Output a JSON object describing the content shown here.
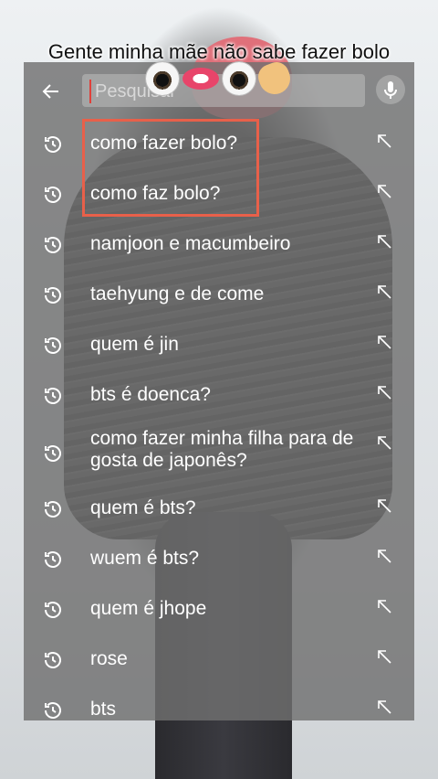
{
  "caption": "Gente minha mãe não sabe fazer bolo",
  "search": {
    "placeholder": "Pesquisar"
  },
  "history": [
    {
      "text": "como fazer bolo?"
    },
    {
      "text": "como faz bolo?"
    },
    {
      "text": "namjoon e macumbeiro"
    },
    {
      "text": "taehyung e de come"
    },
    {
      "text": "quem é jin"
    },
    {
      "text": "bts é doenca?"
    },
    {
      "text": "como fazer minha filha para de gosta de japonês?"
    },
    {
      "text": "quem é bts?"
    },
    {
      "text": "wuem é bts?"
    },
    {
      "text": "quem é jhope"
    },
    {
      "text": "rose"
    },
    {
      "text": "bts"
    }
  ],
  "icons": {
    "back": "back-arrow-icon",
    "mic": "microphone-icon",
    "history": "history-clock-icon",
    "fill": "arrow-up-left-icon"
  },
  "colors": {
    "highlight": "#e8604a",
    "overlay": "#707070"
  }
}
